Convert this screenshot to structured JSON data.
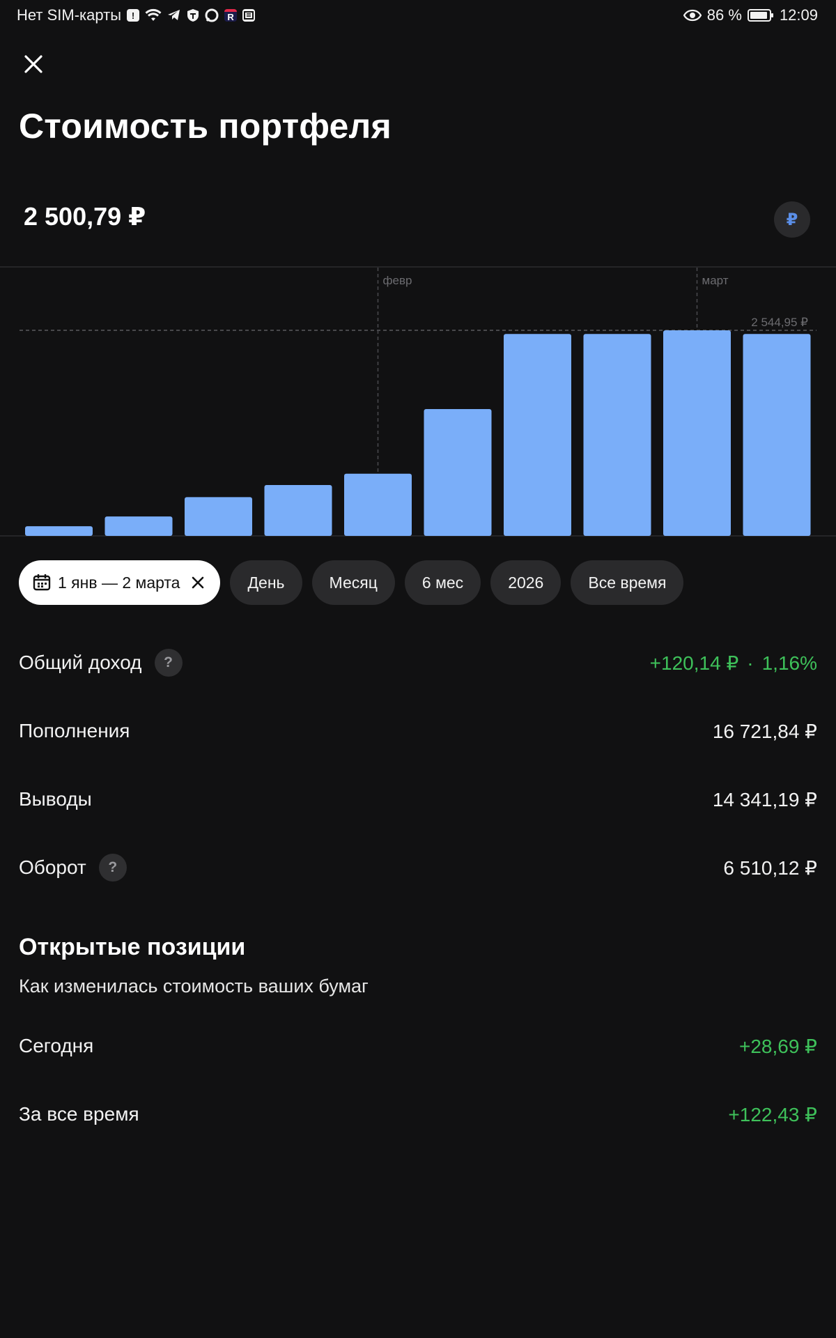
{
  "status_bar": {
    "carrier": "Нет SIM-карты",
    "battery": "86 %",
    "time": "12:09"
  },
  "header": {
    "title": "Стоимость портфеля",
    "value": "2 500,79 ₽",
    "currency_symbol": "₽"
  },
  "chart_data": {
    "type": "bar",
    "month_labels": [
      {
        "label": "февр",
        "at_bar": 4
      },
      {
        "label": "март",
        "at_bar": 8
      }
    ],
    "max_label": "2 544,95 ₽",
    "max_value": 2544.95,
    "values": [
      120,
      240,
      480,
      630,
      770,
      1570,
      2500,
      2500,
      2544.95,
      2500
    ],
    "ylim": [
      0,
      2544.95
    ],
    "bar_color": "#7aaef9"
  },
  "filters": {
    "active_range": "1 янв — 2 марта",
    "chips": [
      "День",
      "Месяц",
      "6 мес",
      "2026",
      "Все время"
    ]
  },
  "stats": {
    "income": {
      "label": "Общий доход",
      "value": "+120,14 ₽",
      "separator": "·",
      "percent": "1,16%"
    },
    "deposits": {
      "label": "Пополнения",
      "value": "16 721,84 ₽"
    },
    "withdrawals": {
      "label": "Выводы",
      "value": "14 341,19 ₽"
    },
    "turnover": {
      "label": "Оборот",
      "value": "6 510,12 ₽"
    },
    "help_symbol": "?"
  },
  "positions": {
    "title": "Открытые позиции",
    "subtitle": "Как изменилась стоимость ваших бумаг",
    "today": {
      "label": "Сегодня",
      "value": "+28,69 ₽"
    },
    "all_time": {
      "label": "За все время",
      "value": "+122,43 ₽"
    }
  },
  "colors": {
    "background": "#111112",
    "accent_green": "#3ec15a",
    "bar": "#7aaef9",
    "chip": "#2a2a2c"
  }
}
